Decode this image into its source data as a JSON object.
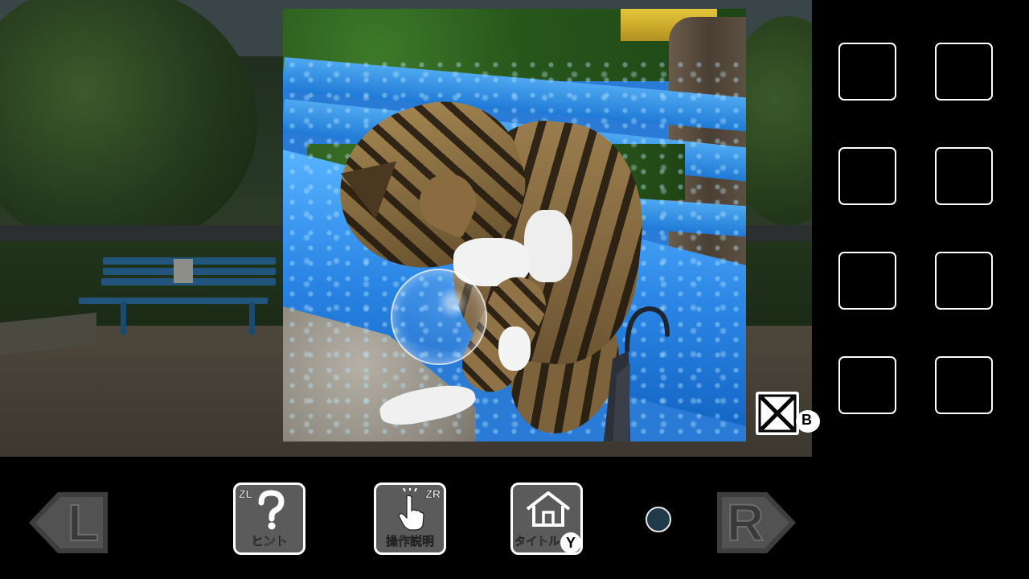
{
  "scene": {
    "description_hidden": ""
  },
  "close_button": {
    "icon": "close-x-icon",
    "key_label": "B"
  },
  "inventory": {
    "slot_count": 8,
    "slots": [
      "",
      "",
      "",
      "",
      "",
      "",
      "",
      ""
    ]
  },
  "nav": {
    "left_key": "L",
    "right_key": "R"
  },
  "menu": {
    "hint": {
      "label": "ヒント",
      "key": "ZL",
      "icon": "question-mark-icon"
    },
    "controls": {
      "label": "操作説明",
      "key": "ZR",
      "icon": "tap-hand-icon"
    },
    "title": {
      "label": "タイトルへ",
      "key": "Y",
      "icon": "house-icon"
    }
  },
  "colors": {
    "bench_blue": "#2b86e5",
    "button_gray": "#5b5b5b",
    "page_dot": "#1f3a48"
  }
}
